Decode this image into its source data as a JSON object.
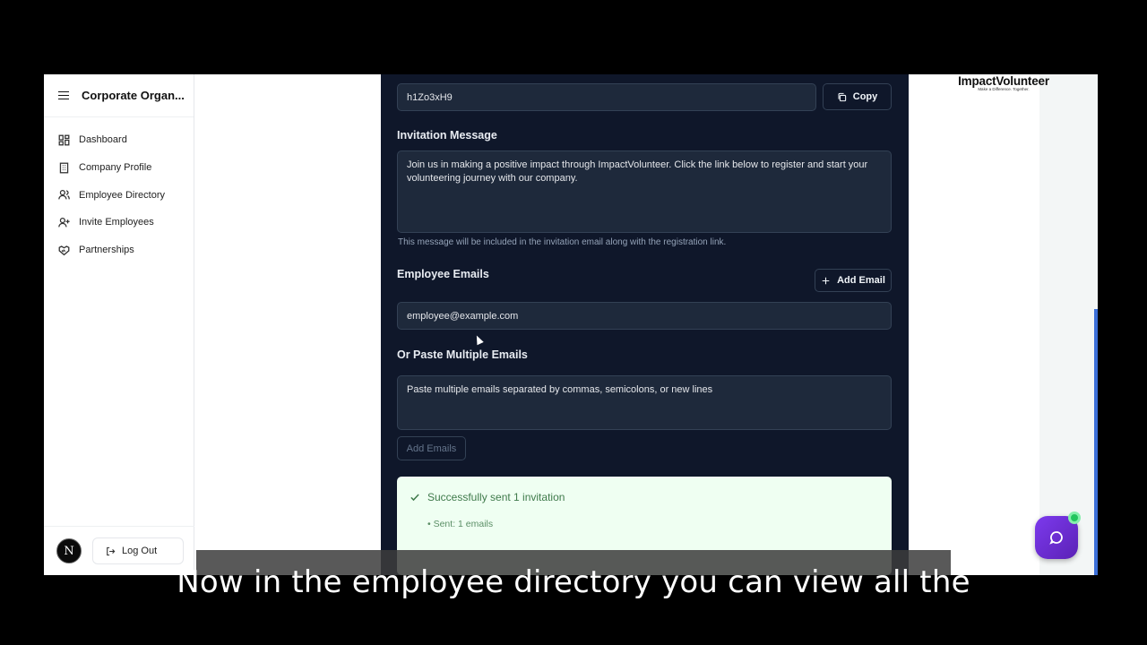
{
  "sidebar": {
    "org_name": "Corporate Organ...",
    "items": [
      {
        "label": "Dashboard",
        "icon": "dashboard-icon"
      },
      {
        "label": "Company Profile",
        "icon": "building-icon"
      },
      {
        "label": "Employee Directory",
        "icon": "users-icon"
      },
      {
        "label": "Invite Employees",
        "icon": "user-plus-icon"
      },
      {
        "label": "Partnerships",
        "icon": "handshake-icon"
      }
    ],
    "avatar_initial": "N",
    "logout_label": "Log Out"
  },
  "brand": {
    "name": "ImpactVolunteer",
    "tagline": "Make a Difference. Together."
  },
  "form": {
    "invite_code": "h1Zo3xH9",
    "copy_label": "Copy",
    "message_label": "Invitation Message",
    "message_text": "Join us in making a positive impact through ImpactVolunteer. Click the link below to register and start your volunteering journey with our company.",
    "message_help": "This message will be included in the invitation email along with the registration link.",
    "emails_label": "Employee Emails",
    "add_email_label": "Add Email",
    "email_placeholder": "employee@example.com",
    "paste_label": "Or Paste Multiple Emails",
    "paste_placeholder": "Paste multiple emails separated by commas, semicolons, or new lines",
    "add_emails_label": "Add Emails"
  },
  "success": {
    "title": "Successfully sent 1 invitation",
    "detail": "• Sent: 1 emails",
    "color": "#3f7a4b"
  },
  "caption": "Now in the employee directory you can view all the"
}
